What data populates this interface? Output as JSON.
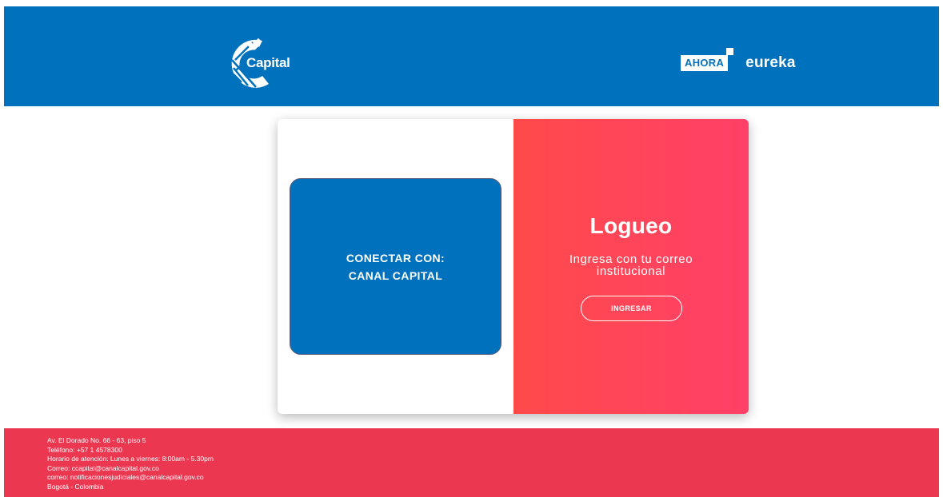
{
  "header": {
    "logo_text": "Capital",
    "partner_ahora": "AHORA",
    "partner_eureka": "eureka",
    "colors": {
      "header_bg": "#0071bc"
    }
  },
  "card": {
    "connect_button": {
      "line1": "CONECTAR CON:",
      "line2": "CANAL CAPITAL"
    },
    "login": {
      "title": "Logueo",
      "subtitle_line1": "Ingresa con tu correo",
      "subtitle_line2": "institucional",
      "button_label": "INGRESAR"
    },
    "colors": {
      "connect_bg": "#0071bc",
      "login_gradient_start": "#ff4a4a",
      "login_gradient_end": "#ff4068"
    }
  },
  "footer": {
    "lines": [
      "Av. El Dorado No. 66 - 63, piso 5",
      "Teléfono: +57 1 4578300",
      "Horario de atención: Lunes a viernes: 8:00am - 5.30pm",
      "Correo: ccapital@canalcapital.gov.co",
      "correo: notificacionesjudiciales@canalcapital.gov.co",
      "Bogotá - Colombia"
    ],
    "colors": {
      "footer_bg": "#ec3751"
    }
  }
}
